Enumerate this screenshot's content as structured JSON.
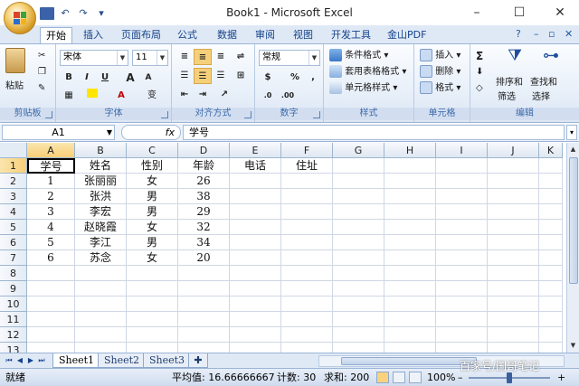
{
  "window": {
    "title": "Book1 - Microsoft Excel",
    "minimize": "–",
    "maximize": "☐",
    "close": "✕"
  },
  "quick_access": {
    "undo": "↶",
    "redo": "↷",
    "more": "▾"
  },
  "ribbon_tabs": [
    "开始",
    "插入",
    "页面布局",
    "公式",
    "数据",
    "审阅",
    "视图",
    "开发工具",
    "金山PDF"
  ],
  "ribbon_tabs_active": "开始",
  "ribbon_right": {
    "help": "?",
    "min": "–",
    "restore": "▫",
    "close": "✕"
  },
  "groups": {
    "clipboard": {
      "label": "剪贴板",
      "paste": "粘贴"
    },
    "font": {
      "label": "字体",
      "font_name": "宋体",
      "font_size": "11",
      "bold": "B",
      "italic": "I",
      "underline": "U",
      "grow": "A",
      "shrink": "A",
      "phonetic": "变"
    },
    "alignment": {
      "label": "对齐方式"
    },
    "number": {
      "label": "数字",
      "format": "常规",
      "percent": "%",
      "comma": ","
    },
    "styles": {
      "label": "样式",
      "conditional": "条件格式",
      "table": "套用表格格式",
      "cell_styles": "单元格样式"
    },
    "cells": {
      "label": "单元格",
      "insert": "插入",
      "delete": "删除",
      "format": "格式"
    },
    "editing": {
      "label": "编辑",
      "sigma": "Σ",
      "sort_l1": "排序和",
      "sort_l2": "筛选",
      "find_l1": "查找和",
      "find_l2": "选择"
    }
  },
  "formula_bar": {
    "name_box": "A1",
    "fx": "fx",
    "content": "学号"
  },
  "columns": [
    "A",
    "B",
    "C",
    "D",
    "E",
    "F",
    "G",
    "H",
    "I",
    "J",
    "K"
  ],
  "rows": [
    "1",
    "2",
    "3",
    "4",
    "5",
    "6",
    "7",
    "8",
    "9",
    "10",
    "11",
    "12",
    "13"
  ],
  "table": {
    "header": [
      "学号",
      "姓名",
      "性别",
      "年龄",
      "电话",
      "住址"
    ],
    "rows": [
      [
        "1",
        "张丽丽",
        "女",
        "26"
      ],
      [
        "2",
        "张洪",
        "男",
        "38"
      ],
      [
        "3",
        "李宏",
        "男",
        "29"
      ],
      [
        "4",
        "赵晓霞",
        "女",
        "32"
      ],
      [
        "5",
        "李江",
        "男",
        "34"
      ],
      [
        "6",
        "苏念",
        "女",
        "20"
      ]
    ]
  },
  "sheets": [
    "Sheet1",
    "Sheet2",
    "Sheet3"
  ],
  "active_sheet": "Sheet1",
  "status": {
    "mode": "就绪",
    "average": "平均值: 16.66666667",
    "count": "计数: 30",
    "sum": "求和: 200",
    "zoom": "100%",
    "zoom_out": "–",
    "zoom_in": "+"
  },
  "watermark": "百家号/国哥笔记"
}
